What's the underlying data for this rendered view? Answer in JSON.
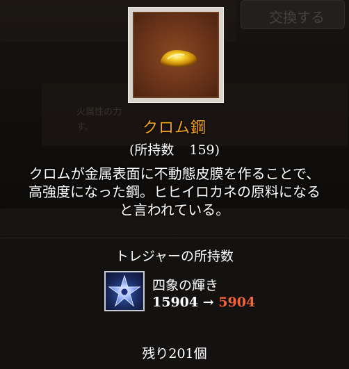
{
  "background": {
    "exchange_button_label": "交換する",
    "hint_line_1": "火属性の力",
    "hint_line_2": "す。"
  },
  "item": {
    "name": "クロム鋼",
    "owned_label": "(所持数",
    "owned_count": "159)",
    "description_line_1": "クロムが金属表面に不動態皮膜を作ることで、",
    "description_line_2": "高強度になった鋼。ヒヒイロカネの原料になる",
    "description_line_3": "と言われている。"
  },
  "treasure": {
    "section_title": "トレジャーの所持数",
    "name": "四象の輝き",
    "count_before": "15904",
    "arrow": "→",
    "count_after": "5904",
    "remaining": "残り201個"
  },
  "colors": {
    "item_name": "#f5a317",
    "count_after": "#f5633a"
  },
  "icons": {
    "item": "chrome-steel-nugget-icon",
    "treasure": "four-symbols-star-icon"
  }
}
